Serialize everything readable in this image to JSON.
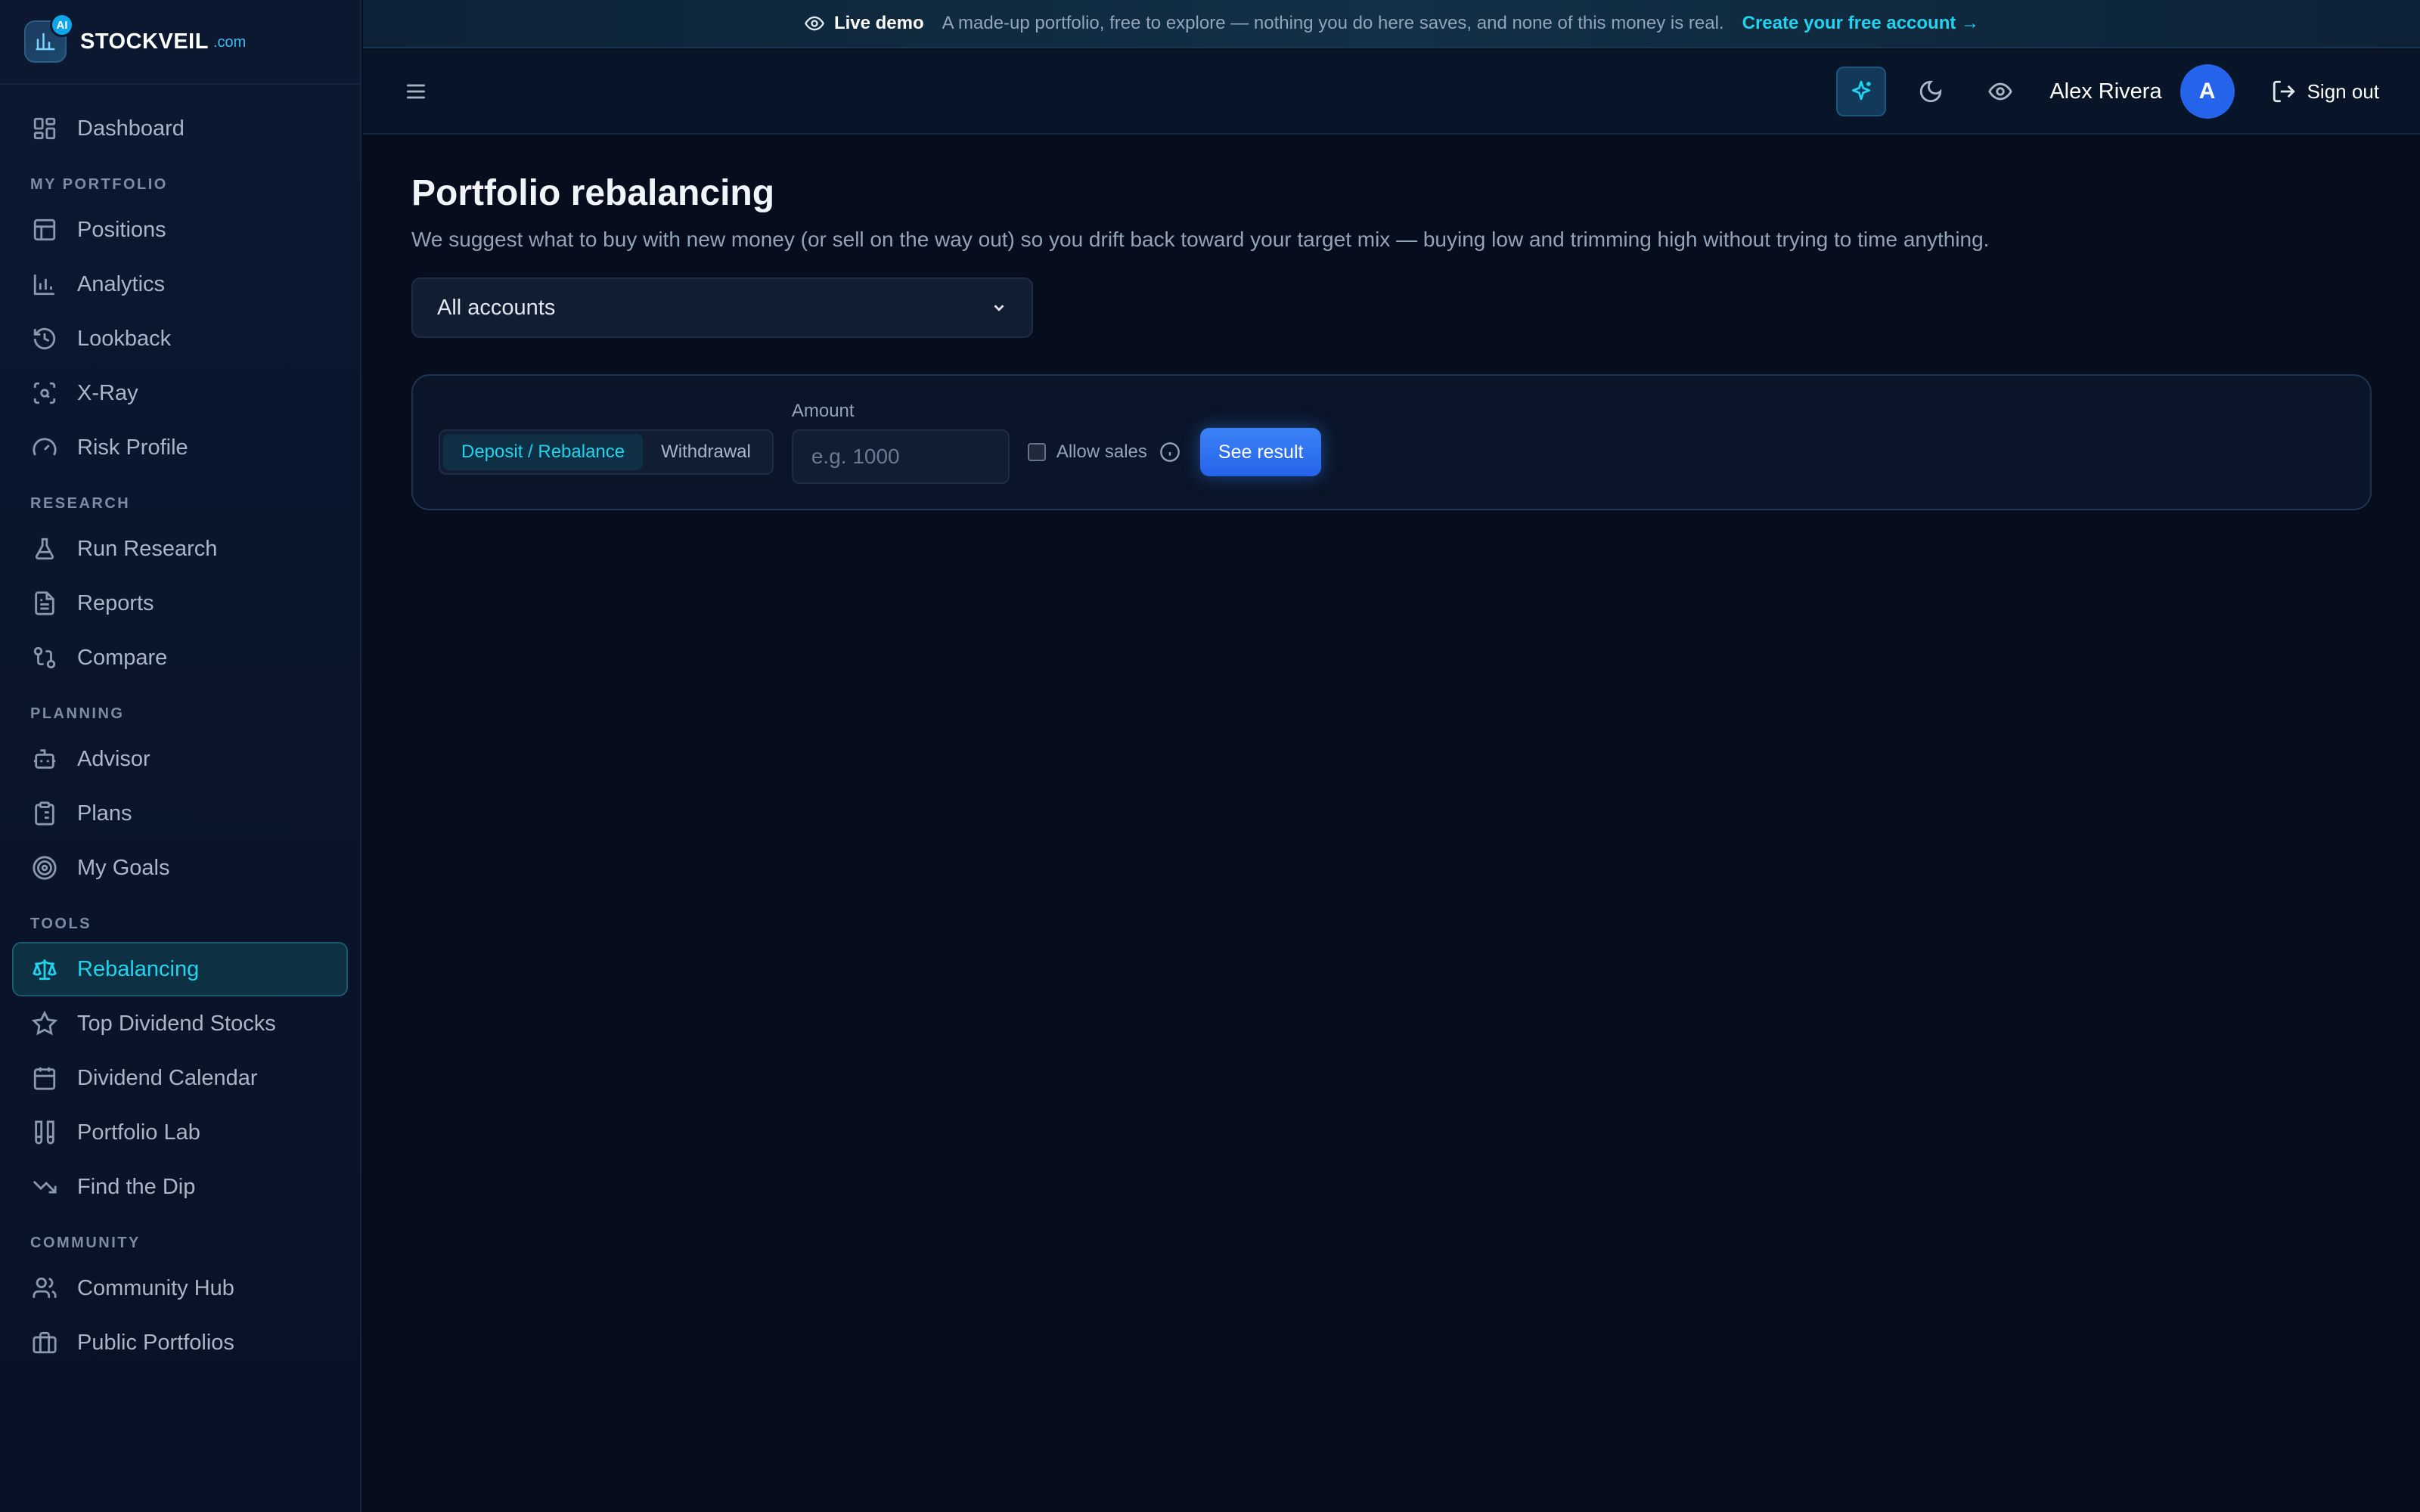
{
  "brand": {
    "badge": "AI",
    "name": "STOCKVEIL",
    "tld": ".com"
  },
  "banner": {
    "live_label": "Live demo",
    "message": "A made-up portfolio, free to explore — nothing you do here saves, and none of this money is real.",
    "cta": "Create your free account →"
  },
  "header": {
    "user_name": "Alex Rivera",
    "avatar_initial": "A",
    "signout_label": "Sign out"
  },
  "sidebar": {
    "dashboard": "Dashboard",
    "sections": {
      "portfolio": "MY PORTFOLIO",
      "research": "RESEARCH",
      "planning": "PLANNING",
      "tools": "TOOLS",
      "community": "COMMUNITY"
    },
    "portfolio_items": [
      "Positions",
      "Analytics",
      "Lookback",
      "X-Ray",
      "Risk Profile"
    ],
    "research_items": [
      "Run Research",
      "Reports",
      "Compare"
    ],
    "planning_items": [
      "Advisor",
      "Plans",
      "My Goals"
    ],
    "tools_items": [
      "Rebalancing",
      "Top Dividend Stocks",
      "Dividend Calendar",
      "Portfolio Lab",
      "Find the Dip"
    ],
    "community_items": [
      "Community Hub",
      "Public Portfolios"
    ],
    "active": "Rebalancing"
  },
  "main": {
    "title": "Portfolio rebalancing",
    "subtitle": "We suggest what to buy with new money (or sell on the way out) so you drift back toward your target mix — buying low and trimming high without trying to time anything.",
    "account_select": "All accounts",
    "mode_options": [
      "Deposit / Rebalance",
      "Withdrawal"
    ],
    "amount_label": "Amount",
    "amount_placeholder": "e.g. 1000",
    "allow_sales_label": "Allow sales",
    "submit_label": "See result"
  },
  "colors": {
    "accent": "#22d3ee",
    "primary": "#2563eb",
    "background": "#060e1e"
  }
}
